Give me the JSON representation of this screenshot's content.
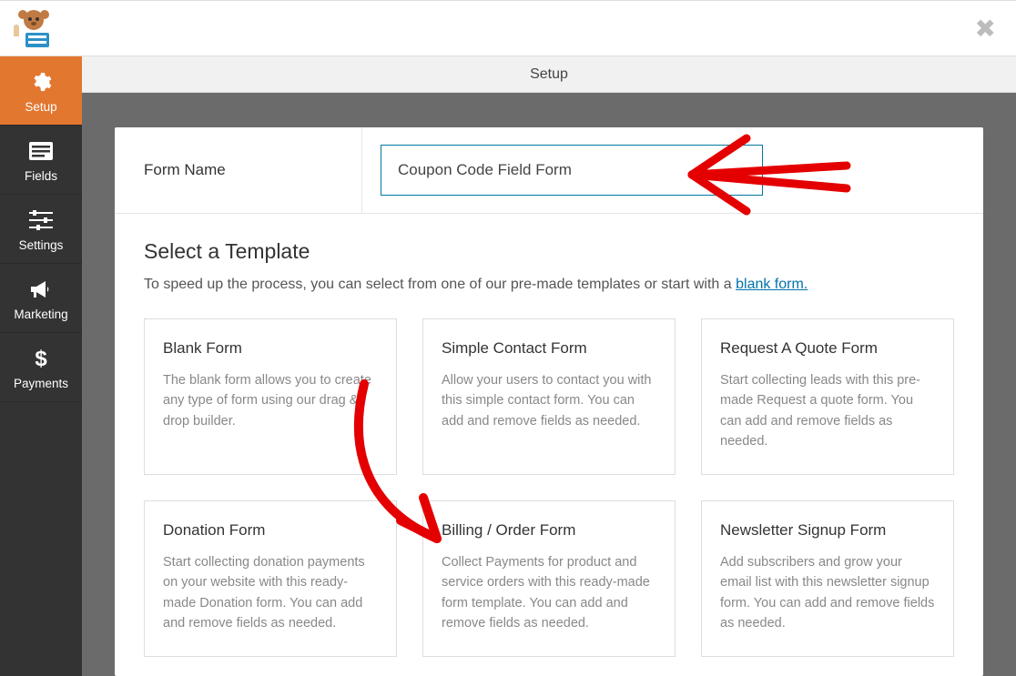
{
  "header": {
    "page_title": "Setup"
  },
  "sidebar": {
    "items": [
      {
        "key": "setup",
        "label": "Setup",
        "icon": "gear-icon",
        "active": true
      },
      {
        "key": "fields",
        "label": "Fields",
        "icon": "list-icon",
        "active": false
      },
      {
        "key": "settings",
        "label": "Settings",
        "icon": "sliders-icon",
        "active": false
      },
      {
        "key": "marketing",
        "label": "Marketing",
        "icon": "bullhorn-icon",
        "active": false
      },
      {
        "key": "payments",
        "label": "Payments",
        "icon": "dollar-icon",
        "active": false
      }
    ]
  },
  "form_name": {
    "label": "Form Name",
    "value": "Coupon Code Field Form"
  },
  "template_section": {
    "heading": "Select a Template",
    "description_pre": "To speed up the process, you can select from one of our pre-made templates or start with a ",
    "description_link": "blank form.",
    "templates": [
      {
        "title": "Blank Form",
        "desc": "The blank form allows you to create any type of form using our drag & drop builder."
      },
      {
        "title": "Simple Contact Form",
        "desc": "Allow your users to contact you with this simple contact form. You can add and remove fields as needed."
      },
      {
        "title": "Request A Quote Form",
        "desc": "Start collecting leads with this pre-made Request a quote form. You can add and remove fields as needed."
      },
      {
        "title": "Donation Form",
        "desc": "Start collecting donation payments on your website with this ready-made Donation form. You can add and remove fields as needed."
      },
      {
        "title": "Billing / Order Form",
        "desc": "Collect Payments for product and service orders with this ready-made form template. You can add and remove fields as needed."
      },
      {
        "title": "Newsletter Signup Form",
        "desc": "Add subscribers and grow your email list with this newsletter signup form. You can add and remove fields as needed."
      }
    ]
  }
}
